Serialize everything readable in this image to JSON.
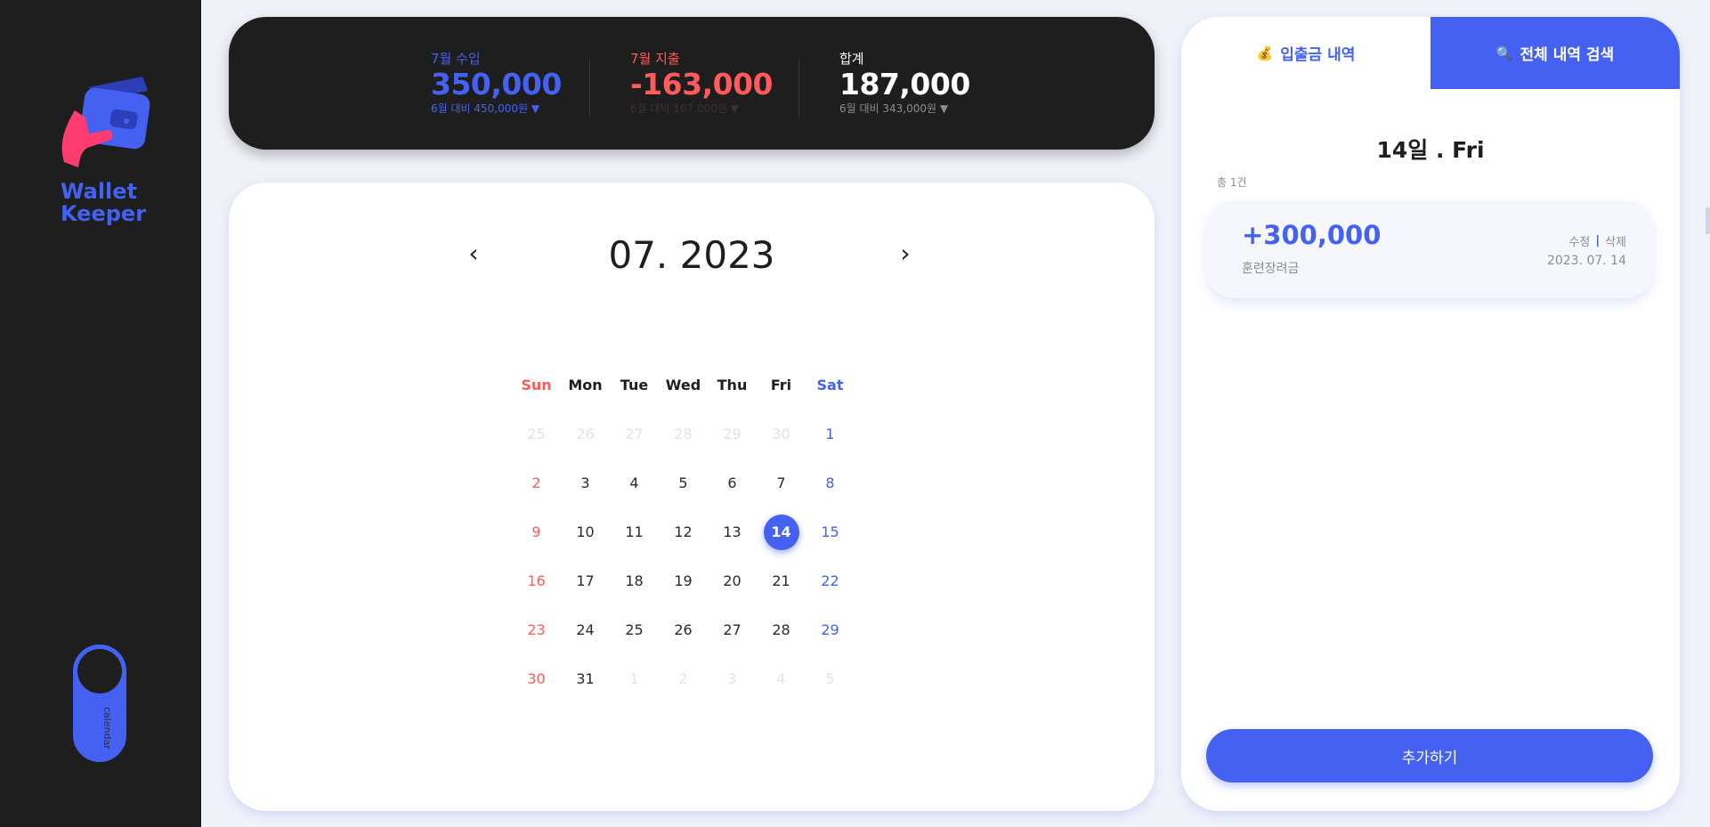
{
  "brand": {
    "line1": "Wallet",
    "line2": "Keeper"
  },
  "view_toggle": {
    "label": "calendar"
  },
  "summary": {
    "income": {
      "label": "7월 수입",
      "value": "350,000",
      "compare": "6월 대비 450,000원 ▼"
    },
    "expense": {
      "label": "7월 지출",
      "value": "-163,000",
      "compare": "6월 대비 107,000원 ▼"
    },
    "total": {
      "label": "합계",
      "value": "187,000",
      "compare": "6월 대비 343,000원 ▼"
    }
  },
  "calendar": {
    "prev": "‹",
    "next": "›",
    "title": "07. 2023",
    "weekdays": [
      "Sun",
      "Mon",
      "Tue",
      "Wed",
      "Thu",
      "Fri",
      "Sat"
    ],
    "weeks": [
      [
        "25",
        "26",
        "27",
        "28",
        "29",
        "30",
        "1"
      ],
      [
        "2",
        "3",
        "4",
        "5",
        "6",
        "7",
        "8"
      ],
      [
        "9",
        "10",
        "11",
        "12",
        "13",
        "14",
        "15"
      ],
      [
        "16",
        "17",
        "18",
        "19",
        "20",
        "21",
        "22"
      ],
      [
        "23",
        "24",
        "25",
        "26",
        "27",
        "28",
        "29"
      ],
      [
        "30",
        "31",
        "1",
        "2",
        "3",
        "4",
        "5"
      ]
    ],
    "selected_day": "14"
  },
  "panel": {
    "tabs": {
      "history": {
        "icon": "💰",
        "label": "입출금 내역"
      },
      "search": {
        "icon": "🔍",
        "label": "전체 내역 검색"
      }
    },
    "day_title": "14일 . Fri",
    "count": "총 1건",
    "entry": {
      "amount": "+300,000",
      "memo": "훈련장려금",
      "edit": "수정",
      "sep": "|",
      "delete": "삭제",
      "date": "2023. 07. 14"
    },
    "add_button": "추가하기"
  },
  "colors": {
    "accent": "#4461f2",
    "expense": "#ff5b5b",
    "dark": "#1e1e1e",
    "background": "#f0f2f9"
  }
}
